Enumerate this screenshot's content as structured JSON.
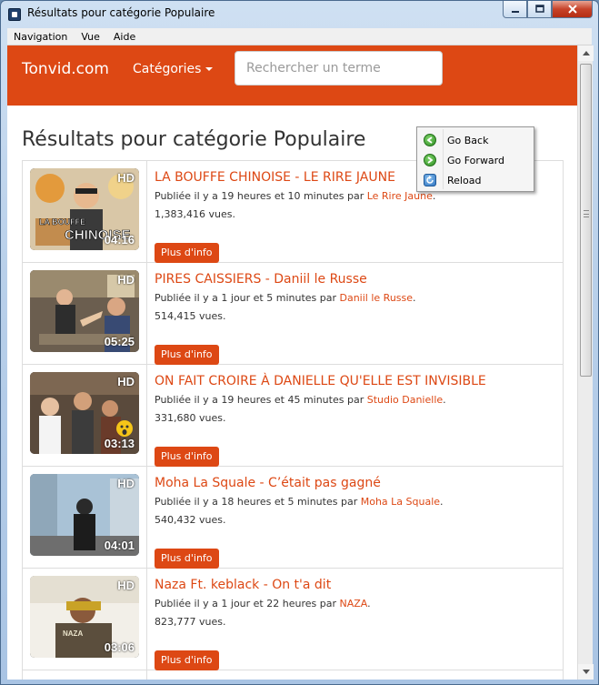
{
  "window": {
    "title": "Résultats pour catégorie Populaire"
  },
  "menubar": {
    "items": [
      "Navigation",
      "Vue",
      "Aide"
    ]
  },
  "navbar": {
    "brand": "Tonvid.com",
    "categories_label": "Catégories",
    "search_placeholder": "Rechercher un terme"
  },
  "page": {
    "heading": "Résultats pour catégorie Populaire"
  },
  "videos": [
    {
      "title": "LA BOUFFE CHINOISE - LE RIRE JAUNE",
      "published_prefix": "Publiée il y a 19 heures et 10 minutes par ",
      "channel": "Le Rire Jaune",
      "published_suffix": ".",
      "views": "1,383,416 vues.",
      "duration": "04:16",
      "quality": "HD",
      "thumb_caption": "LA BOUFFE CHINOISE",
      "button": "Plus d'info"
    },
    {
      "title": "PIRES CAISSIERS - Daniil le Russe",
      "published_prefix": "Publiée il y a 1 jour et 5 minutes par ",
      "channel": "Daniil le Russe",
      "published_suffix": ".",
      "views": "514,415 vues.",
      "duration": "05:25",
      "quality": "HD",
      "button": "Plus d'info"
    },
    {
      "title": "ON FAIT CROIRE À DANIELLE QU'ELLE EST INVISIBLE",
      "published_prefix": "Publiée il y a 19 heures et 45 minutes par ",
      "channel": "Studio Danielle",
      "published_suffix": ".",
      "views": "331,680 vues.",
      "duration": "03:13",
      "quality": "HD",
      "button": "Plus d'info"
    },
    {
      "title": "Moha La Squale - C’était pas gagné",
      "published_prefix": "Publiée il y a 18 heures et 5 minutes par ",
      "channel": "Moha La Squale",
      "published_suffix": ".",
      "views": "540,432 vues.",
      "duration": "04:01",
      "quality": "HD",
      "button": "Plus d'info"
    },
    {
      "title": "Naza Ft. keblack - On t'a dit",
      "published_prefix": "Publiée il y a 1 jour et 22 heures par ",
      "channel": "NAZA",
      "published_suffix": ".",
      "views": "823,777 vues.",
      "duration": "03:06",
      "quality": "HD",
      "button": "Plus d'info"
    }
  ],
  "context_menu": {
    "items": [
      {
        "label": "Go Back",
        "icon": "arrow-left-icon"
      },
      {
        "label": "Go Forward",
        "icon": "arrow-right-icon"
      },
      {
        "label": "Reload",
        "icon": "reload-icon"
      }
    ]
  },
  "colors": {
    "accent": "#dd4814",
    "text": "#333333",
    "border": "#dddddd"
  }
}
